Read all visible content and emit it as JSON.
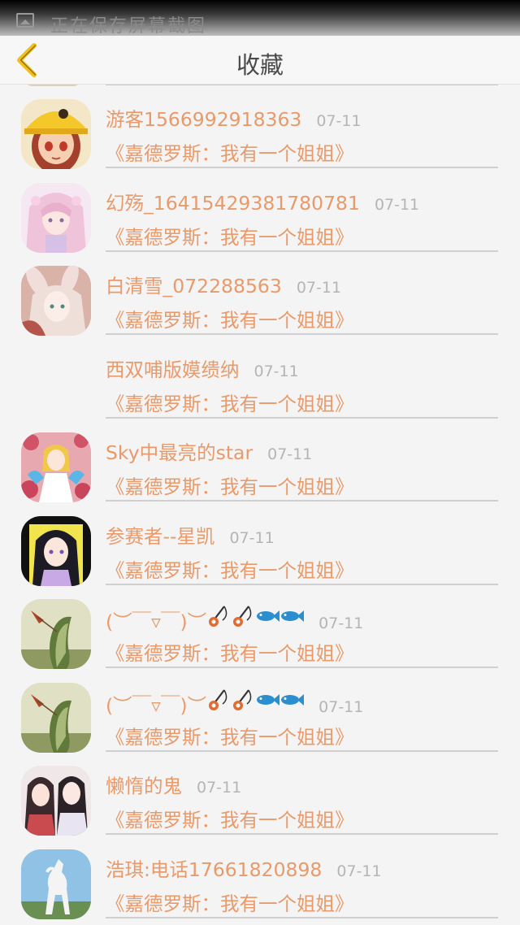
{
  "status_bar": {
    "notification_text": "正在保存屏幕截图",
    "icon": "screenshot-icon"
  },
  "header": {
    "title": "收藏",
    "back_icon": "chevron-left-icon",
    "back_color": "#f2c01c"
  },
  "colors": {
    "accent_text": "#e99a6a",
    "date_text": "#b5b5b5",
    "background": "#f4f4f4"
  },
  "favorites": [
    {
      "user": "游客1566992918363",
      "date": "07-11",
      "book": "《嘉德罗斯：我有一个姐姐》",
      "avatar": "avatar-cap-boy"
    },
    {
      "user": "幻殇_16415429381780781",
      "date": "07-11",
      "book": "《嘉德罗斯：我有一个姐姐》",
      "avatar": "avatar-pink-girl"
    },
    {
      "user": "白清雪_072288563",
      "date": "07-11",
      "book": "《嘉德罗斯：我有一个姐姐》",
      "avatar": "avatar-rabbit-girl"
    },
    {
      "user": "西双哺版嫫缋纳",
      "date": "07-11",
      "book": "《嘉德罗斯：我有一个姐姐》",
      "avatar": "none"
    },
    {
      "user": "Sky中最亮的star",
      "date": "07-11",
      "book": "《嘉德罗斯：我有一个姐姐》",
      "avatar": "avatar-flower-girl"
    },
    {
      "user": "参赛者--星凯",
      "date": "07-11",
      "book": "《嘉德罗斯：我有一个姐姐》",
      "avatar": "avatar-dark-hair-girl"
    },
    {
      "user": "(︶￣▿￣)︶",
      "date": "07-11",
      "book": "《嘉德罗斯：我有一个姐姐》",
      "avatar": "avatar-bass-fish",
      "emoji": [
        "fishing-pole-icon",
        "fishing-pole-icon",
        "fish-icon",
        "fish-icon"
      ]
    },
    {
      "user": "(︶￣▿￣)︶",
      "date": "07-11",
      "book": "《嘉德罗斯：我有一个姐姐》",
      "avatar": "avatar-bass-fish",
      "emoji": [
        "fishing-pole-icon",
        "fishing-pole-icon",
        "fish-icon",
        "fish-icon"
      ]
    },
    {
      "user": "懒惰的鬼",
      "date": "07-11",
      "book": "《嘉德罗斯：我有一个姐姐》",
      "avatar": "avatar-two-girls"
    },
    {
      "user": "浩琪:电话17661820898",
      "date": "07-11",
      "book": "《嘉德罗斯：我有一个姐姐》",
      "avatar": "avatar-white-horse"
    }
  ]
}
